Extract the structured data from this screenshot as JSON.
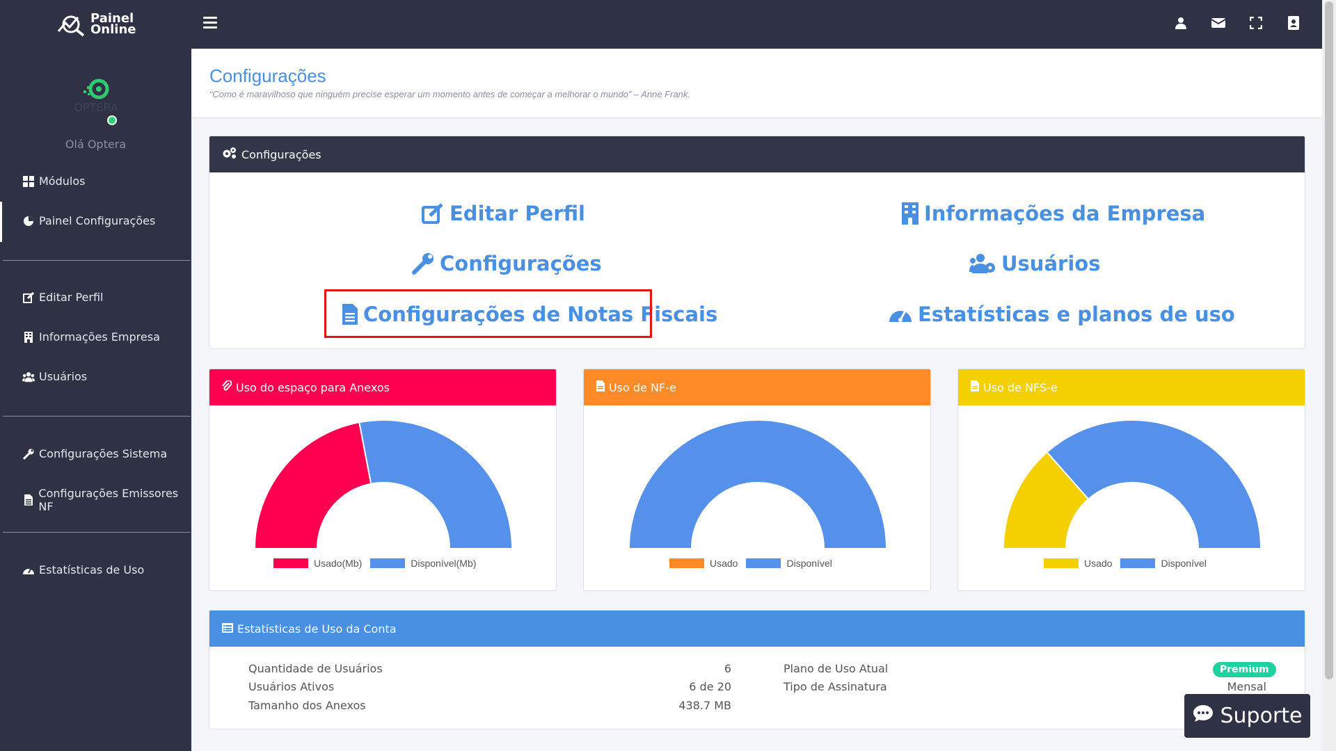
{
  "app": {
    "logo_line1": "Painel",
    "logo_line2": "Online"
  },
  "sidebar": {
    "greeting": "Olá Optera",
    "items": [
      {
        "label": "Módulos",
        "icon": "grid-icon"
      },
      {
        "label": "Painel Configurações",
        "icon": "pie-chart-icon"
      },
      {
        "label": "Editar Perfil",
        "icon": "edit-icon"
      },
      {
        "label": "Informações Empresa",
        "icon": "building-icon"
      },
      {
        "label": "Usuários",
        "icon": "users-icon"
      },
      {
        "label": "Configurações Sistema",
        "icon": "wrench-icon"
      },
      {
        "label": "Configurações Emissores NF",
        "icon": "file-icon"
      },
      {
        "label": "Estatísticas de Uso",
        "icon": "gauge-icon"
      }
    ]
  },
  "header": {
    "title": "Configurações",
    "quote": "“Como é maravilhoso que ninguém precise esperar um momento antes de começar a melhorar o mundo” – Anne Frank."
  },
  "config_card": {
    "title": "Configurações",
    "links": [
      {
        "label": "Editar Perfil",
        "icon": "edit-icon"
      },
      {
        "label": "Informações da Empresa",
        "icon": "building-icon"
      },
      {
        "label": "Configurações",
        "icon": "wrench-icon"
      },
      {
        "label": "Usuários",
        "icon": "users-cog-icon"
      },
      {
        "label": "Configurações de Notas Fiscais",
        "icon": "file-invoice-icon"
      },
      {
        "label": "Estatísticas e planos de uso",
        "icon": "gauge-icon"
      }
    ]
  },
  "gauges": [
    {
      "title": "Uso do espaço para Anexos",
      "header_color": "#ff0050",
      "used_label": "Usado(Mb)",
      "free_label": "Disponível(Mb)",
      "used_color": "#ff0050",
      "free_color": "#5591ea",
      "used_fraction": 0.44
    },
    {
      "title": "Uso de NF-e",
      "header_color": "#ff8a28",
      "used_label": "Usado",
      "free_label": "Disponível",
      "used_color": "#ff8a28",
      "free_color": "#5591ea",
      "used_fraction": 0.0
    },
    {
      "title": "Uso de NFS-e",
      "header_color": "#f5d000",
      "used_label": "Usado",
      "free_label": "Disponível",
      "used_color": "#f5d000",
      "free_color": "#5591ea",
      "used_fraction": 0.27
    }
  ],
  "stats": {
    "title": "Estatísticas de Uso da Conta",
    "rows": [
      {
        "label": "Quantidade de Usuários",
        "value": "6"
      },
      {
        "label": "Usuários Ativos",
        "value": "6 de 20"
      },
      {
        "label": "Tamanho dos Anexos",
        "value": "438.7 MB"
      }
    ],
    "plan_label": "Plano de Uso Atual",
    "plan_value": "Premium",
    "subscription_label": "Tipo de Assinatura",
    "subscription_value": "Mensal"
  },
  "support": {
    "label": "Suporte"
  }
}
